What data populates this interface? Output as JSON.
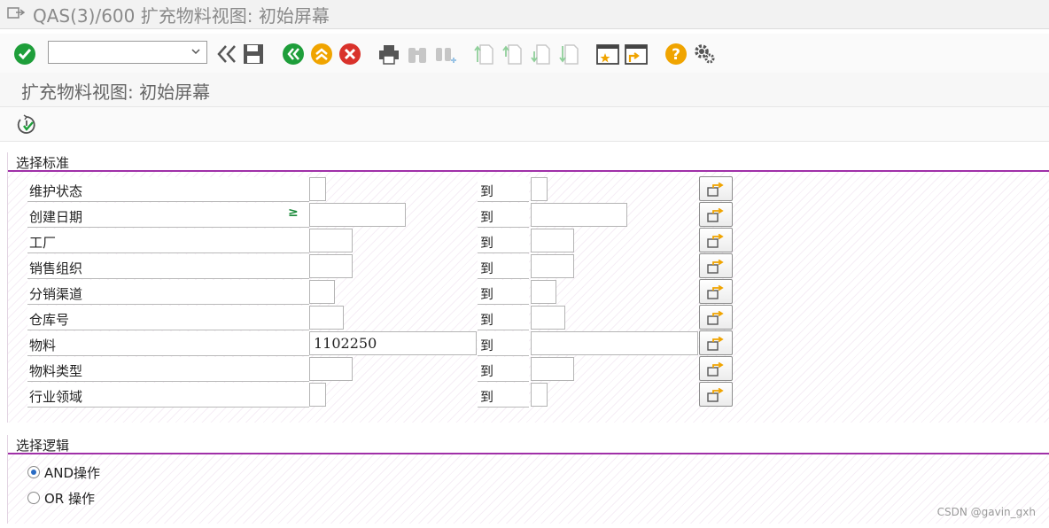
{
  "window": {
    "title": "QAS(3)/600 扩充物料视图: 初始屏幕"
  },
  "toolbar": {
    "command_field_value": "",
    "icons": [
      "enter-check-icon",
      "command-dropdown",
      "back-double-icon",
      "save-icon",
      "back-icon",
      "exit-icon",
      "cancel-icon",
      "print-icon",
      "find-icon",
      "find-next-icon",
      "first-page-icon",
      "prev-page-icon",
      "next-page-icon",
      "last-page-icon",
      "new-session-icon",
      "shortcut-icon",
      "help-icon",
      "settings-icon"
    ]
  },
  "screen": {
    "title": "扩充物料视图: 初始屏幕"
  },
  "app_toolbar": {
    "execute_icon": "execute-icon"
  },
  "selection_criteria": {
    "title": "选择标准",
    "to_label": "到",
    "rows": [
      {
        "label": "维护状态",
        "from": "",
        "to": "",
        "ge": ""
      },
      {
        "label": "创建日期",
        "from": "",
        "to": "",
        "ge": "≥"
      },
      {
        "label": "工厂",
        "from": "",
        "to": "",
        "ge": ""
      },
      {
        "label": "销售组织",
        "from": "",
        "to": "",
        "ge": ""
      },
      {
        "label": "分销渠道",
        "from": "",
        "to": "",
        "ge": ""
      },
      {
        "label": "仓库号",
        "from": "",
        "to": "",
        "ge": ""
      },
      {
        "label": "物料",
        "from": "1102250",
        "to": "",
        "ge": ""
      },
      {
        "label": "物料类型",
        "from": "",
        "to": "",
        "ge": ""
      },
      {
        "label": "行业领域",
        "from": "",
        "to": "",
        "ge": ""
      }
    ]
  },
  "selection_logic": {
    "title": "选择逻辑",
    "options": [
      {
        "label": "AND操作",
        "selected": true
      },
      {
        "label": "OR 操作",
        "selected": false
      }
    ]
  },
  "watermark": "CSDN @gavin_gxh",
  "colors": {
    "accent": "#a030a8",
    "ok_green": "#1e9e3a",
    "cancel_red": "#d9322b",
    "help_orange": "#f0a400"
  }
}
